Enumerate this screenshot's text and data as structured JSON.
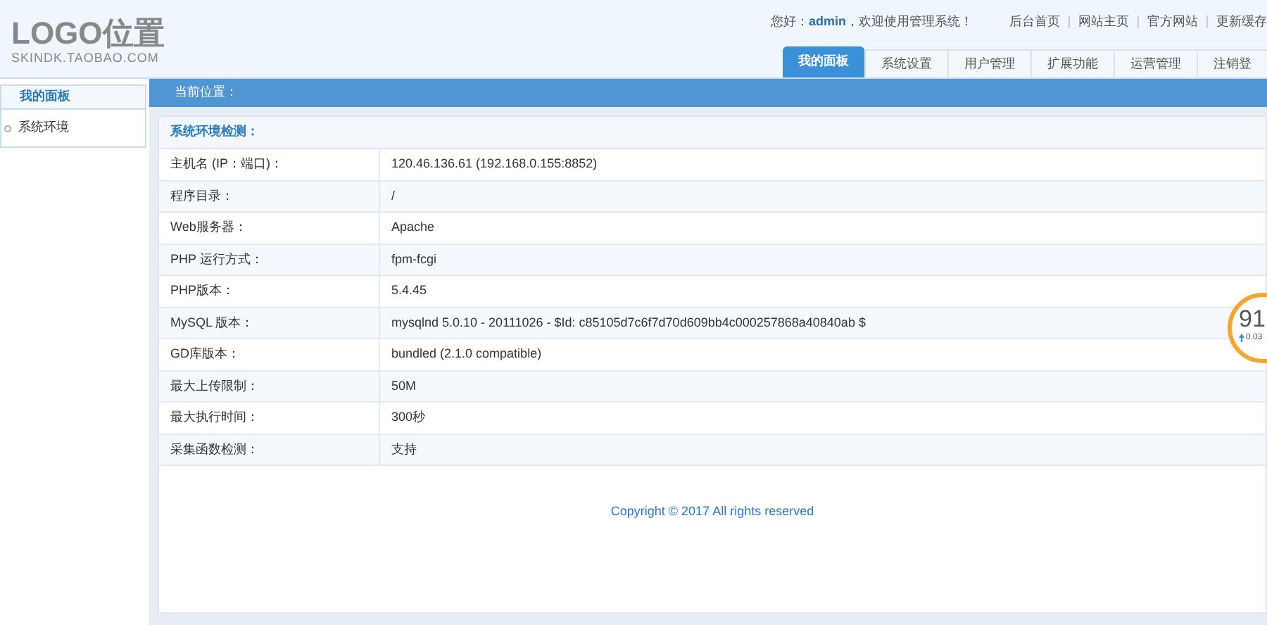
{
  "logo": {
    "title": "LOGO位置",
    "subtitle": "SKINDK.TAOBAO.COM"
  },
  "greeting": {
    "prefix": "您好：",
    "user": "admin",
    "suffix": "，欢迎使用管理系统！"
  },
  "top_links": [
    "后台首页",
    "网站主页",
    "官方网站",
    "更新缓存"
  ],
  "tabs": [
    {
      "label": "我的面板",
      "selected": true
    },
    {
      "label": "系统设置",
      "selected": false
    },
    {
      "label": "用户管理",
      "selected": false
    },
    {
      "label": "扩展功能",
      "selected": false
    },
    {
      "label": "运营管理",
      "selected": false
    },
    {
      "label": "注销登",
      "selected": false
    }
  ],
  "sidebar": {
    "title": "我的面板",
    "items": [
      {
        "label": "系统环境",
        "selected": false
      }
    ]
  },
  "breadcrumb": "当前位置：",
  "section_title": "系统环境检测：",
  "rows": [
    {
      "label": "主机名 (IP：端口)：",
      "value": "120.46.136.61 (192.168.0.155:8852)"
    },
    {
      "label": "程序目录：",
      "value": "/"
    },
    {
      "label": "Web服务器：",
      "value": "Apache"
    },
    {
      "label": "PHP 运行方式：",
      "value": "fpm-fcgi"
    },
    {
      "label": "PHP版本：",
      "value": "5.4.45"
    },
    {
      "label": "MySQL 版本：",
      "value": "mysqlnd 5.0.10 - 20111026 - $Id: c85105d7c6f7d70d609bb4c000257868a40840ab $"
    },
    {
      "label": "GD库版本：",
      "value": "bundled (2.1.0 compatible)"
    },
    {
      "label": "最大上传限制：",
      "value": "50M"
    },
    {
      "label": "最大执行时间：",
      "value": "300秒"
    },
    {
      "label": "采集函数检测：",
      "value": "支持"
    }
  ],
  "footer": "Copyright © 2017 All rights reserved",
  "speed_badge": {
    "score": "91",
    "delta": "0.03"
  }
}
